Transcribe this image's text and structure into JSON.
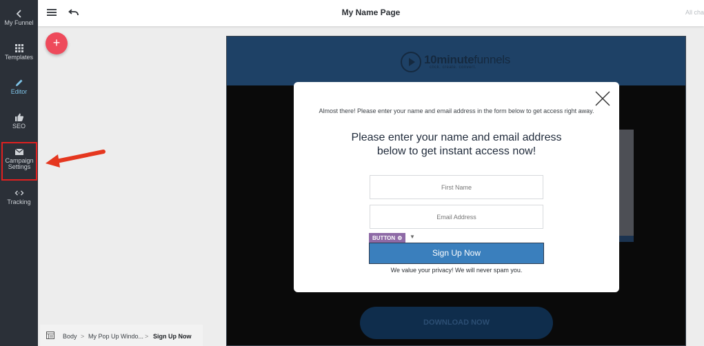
{
  "sidebar": {
    "items": [
      {
        "label": "My Funnel",
        "icon": "chevron-left-icon"
      },
      {
        "label": "Templates",
        "icon": "grid-icon"
      },
      {
        "label": "Editor",
        "icon": "pencil-icon"
      },
      {
        "label": "SEO",
        "icon": "thumbs-up-icon"
      },
      {
        "label_line1": "Campaign",
        "label_line2": "Settings",
        "icon": "envelope-icon"
      },
      {
        "label": "Tracking",
        "icon": "code-icon"
      }
    ]
  },
  "topbar": {
    "title": "My Name Page",
    "right_text": "All cha",
    "menu_icon": "hamburger-menu-icon",
    "undo_icon": "undo-icon"
  },
  "fab": {
    "label": "+"
  },
  "canvas": {
    "logo_bold": "10minute",
    "logo_light": "funnels",
    "logo_tagline": "click. create. convert.",
    "download_label": "DOWNLOAD NOW"
  },
  "modal": {
    "pre_text": "Almost there!  Please enter your name and email address in the form below to get access right away.",
    "headline_line1": "Please enter your name and email address",
    "headline_line2": "below to get instant access now!",
    "first_name_placeholder": "First Name",
    "email_placeholder": "Email Address",
    "button_tag": "BUTTON",
    "button_label": "Sign Up Now",
    "privacy_text": "We value your privacy!  We will never spam you."
  },
  "breadcrumb": {
    "items": [
      "Body",
      "My Pop Up Windo...",
      "Sign Up Now"
    ],
    "separator": ">"
  },
  "colors": {
    "sidebar_bg": "#2b3038",
    "active": "#7fc4e8",
    "fab": "#ee4a5b",
    "header_blue": "#1e4166",
    "signup_button": "#3a7fbd",
    "button_tag": "#8e6aa6",
    "highlight": "#e02020"
  }
}
